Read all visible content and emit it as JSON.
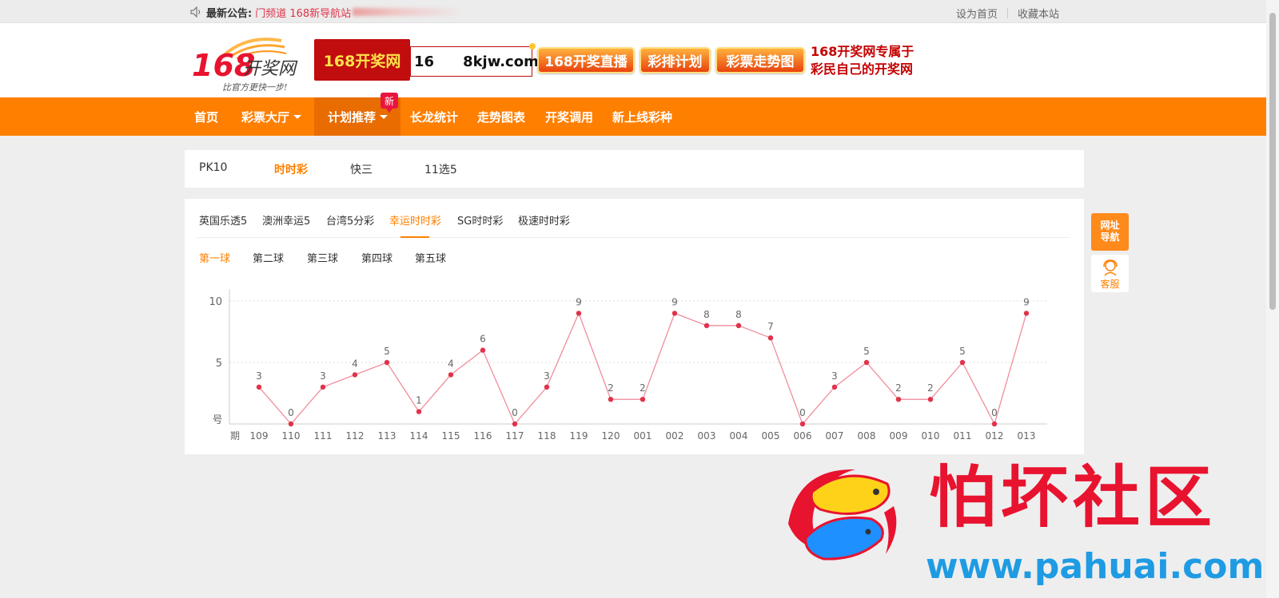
{
  "topbar": {
    "notice_label": "最新公告:",
    "notice_text": "门频道 168新导航站",
    "link_home": "设为首页",
    "link_fav": "收藏本站"
  },
  "header": {
    "banner_site": "168开奖网",
    "banner_url_prefix": "16",
    "banner_url_domain": "8kjw.com",
    "pills": [
      "168开奖直播",
      "彩排计划",
      "彩票走势图"
    ],
    "slogan_line1": "168开奖网专属于",
    "slogan_line2": "彩民自己的开奖网"
  },
  "nav": {
    "items": [
      "首页",
      "彩票大厅",
      "计划推荐",
      "长龙统计",
      "走势图表",
      "开奖调用",
      "新上线彩种"
    ],
    "new_badge": "新"
  },
  "category_tabs": {
    "items": [
      "PK10",
      "时时彩",
      "快三",
      "11选5"
    ],
    "active": "时时彩"
  },
  "lottery_tabs": {
    "items": [
      "英国乐透5",
      "澳洲幸运5",
      "台湾5分彩",
      "幸运时时彩",
      "SG时时彩",
      "极速时时彩"
    ],
    "active": "幸运时时彩"
  },
  "ball_tabs": {
    "items": [
      "第一球",
      "第二球",
      "第三球",
      "第四球",
      "第五球"
    ],
    "active": "第一球"
  },
  "side": {
    "nav_label_1": "网址",
    "nav_label_2": "导航",
    "service_label": "客服"
  },
  "watermark": {
    "title": "怕坏社区",
    "url": "www.pahuai.com"
  },
  "chart_data": {
    "type": "line",
    "xlabel": "期",
    "ylabel": "号",
    "categories": [
      "109",
      "110",
      "111",
      "112",
      "113",
      "114",
      "115",
      "116",
      "117",
      "118",
      "119",
      "120",
      "001",
      "002",
      "003",
      "004",
      "005",
      "006",
      "007",
      "008",
      "009",
      "010",
      "011",
      "012",
      "013"
    ],
    "values": [
      3,
      0,
      3,
      4,
      5,
      1,
      4,
      6,
      0,
      3,
      9,
      2,
      2,
      9,
      8,
      8,
      7,
      0,
      3,
      5,
      2,
      2,
      5,
      0,
      9
    ],
    "yticks": [
      5,
      10
    ],
    "ylim": [
      0,
      10
    ],
    "grid": true,
    "colors": {
      "line": "#f08d9c",
      "point": "#e0334a",
      "grid": "#dddddd",
      "axis": "#cccccc",
      "label": "#666666"
    }
  }
}
